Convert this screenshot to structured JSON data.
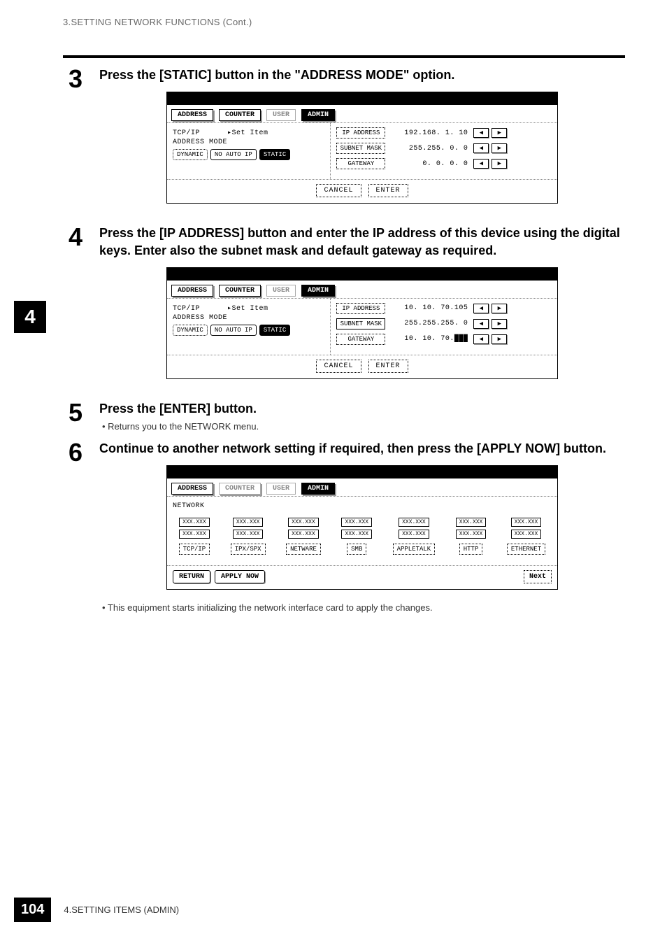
{
  "header": {
    "breadcrumb": "3.SETTING NETWORK FUNCTIONS (Cont.)"
  },
  "sidebar_badge": "4",
  "steps": {
    "s3": {
      "num": "3",
      "title": "Press the [STATIC] button in the \"ADDRESS MODE\" option."
    },
    "s4": {
      "num": "4",
      "title": "Press the [IP ADDRESS] button and enter the IP address of this device using the digital keys.  Enter also the subnet mask and default gateway as required."
    },
    "s5": {
      "num": "5",
      "title": "Press the [ENTER] button.",
      "bullet": "•   Returns you to the NETWORK menu."
    },
    "s6": {
      "num": "6",
      "title": "Continue to another network setting if required, then press the [APPLY NOW] button.",
      "bullet": "•   This equipment starts initializing the network interface card to apply the changes."
    }
  },
  "screen_common": {
    "tab_address": "ADDRESS",
    "tab_counter": "COUNTER",
    "tab_user": "USER",
    "tab_admin": "ADMIN",
    "tcpip": "TCP/IP",
    "set_item": "▸Set Item",
    "addr_mode": "ADDRESS MODE",
    "dynamic": "DYNAMIC",
    "no_auto": "NO AUTO IP",
    "static": "STATIC",
    "ip_address": "IP ADDRESS",
    "subnet_mask": "SUBNET MASK",
    "gateway": "GATEWAY",
    "left_arrow": "◀",
    "right_arrow": "▶",
    "cancel": "CANCEL",
    "enter": "ENTER"
  },
  "screen1": {
    "ip_val": "192.168.  1. 10",
    "mask_val": "255.255.  0.  0",
    "gw_val": "  0.  0.  0.  0"
  },
  "screen2": {
    "ip_val": " 10. 10. 70.105",
    "mask_val": "255.255.255.  0",
    "gw_val": " 10. 10. 70.███"
  },
  "screen3": {
    "network": "NETWORK",
    "items": [
      "TCP/IP",
      "IPX/SPX",
      "NETWARE",
      "SMB",
      "APPLETALK",
      "HTTP",
      "ETHERNET"
    ],
    "xxx": "XXX.XXX",
    "return": "RETURN",
    "apply": "APPLY NOW",
    "next": "Next"
  },
  "footer": {
    "page": "104",
    "text": "4.SETTING ITEMS (ADMIN)"
  }
}
